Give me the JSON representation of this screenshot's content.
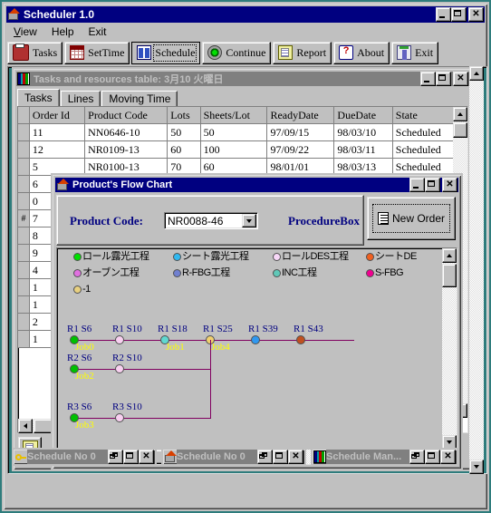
{
  "app": {
    "title": "Scheduler 1.0",
    "icon": "house-icon",
    "menu": [
      "View",
      "Help",
      "Exit"
    ],
    "window_buttons": [
      "minimize",
      "maximize",
      "close"
    ]
  },
  "toolbar": {
    "buttons": [
      {
        "label": "Tasks",
        "icon": "printer-icon",
        "pressed": false
      },
      {
        "label": "SetTime",
        "icon": "calendar-icon",
        "pressed": false
      },
      {
        "label": "Schedule",
        "icon": "schedule-icon",
        "pressed": true
      },
      {
        "label": "Continue",
        "icon": "green-ball-icon",
        "pressed": false
      },
      {
        "label": "Report",
        "icon": "report-icon",
        "pressed": false
      },
      {
        "label": "About",
        "icon": "about-icon",
        "pressed": false
      },
      {
        "label": "Exit",
        "icon": "exit-door-icon",
        "pressed": false
      }
    ]
  },
  "tasks_window": {
    "title": "Tasks and resources table: 3月10  火曜日",
    "icon": "grid-icon",
    "tabs": [
      {
        "label": "Tasks",
        "active": true
      },
      {
        "label": "Lines",
        "active": false
      },
      {
        "label": "Moving Time",
        "active": false
      }
    ],
    "grid": {
      "columns": [
        "",
        "Order Id",
        "Product Code",
        "Lots",
        "Sheets/Lot",
        "ReadyDate",
        "DueDate",
        "State"
      ],
      "rows": [
        [
          "",
          "11",
          "NN0646-10",
          "50",
          "50",
          "97/09/15",
          "98/03/10",
          "Scheduled"
        ],
        [
          "",
          "12",
          "NR0109-13",
          "60",
          "100",
          "97/09/22",
          "98/03/11",
          "Scheduled"
        ],
        [
          "",
          "5",
          "NR0100-13",
          "70",
          "60",
          "98/01/01",
          "98/03/13",
          "Scheduled"
        ],
        [
          "",
          "6",
          "",
          "",
          "",
          "",
          "",
          ""
        ],
        [
          "",
          "0",
          "",
          "",
          "",
          "",
          "",
          ""
        ],
        [
          "#",
          "7",
          "",
          "",
          "",
          "",
          "",
          ""
        ],
        [
          "",
          "8",
          "",
          "",
          "",
          "",
          "",
          ""
        ],
        [
          "",
          "9",
          "",
          "",
          "",
          "",
          "",
          ""
        ],
        [
          "",
          "4",
          "",
          "",
          "",
          "",
          "",
          ""
        ],
        [
          "",
          "1",
          "",
          "",
          "",
          "",
          "",
          ""
        ],
        [
          "",
          "1",
          "",
          "",
          "",
          "",
          "",
          ""
        ],
        [
          "",
          "2",
          "",
          "",
          "",
          "",
          "",
          ""
        ],
        [
          "",
          "1",
          "",
          "",
          "",
          "",
          "",
          ""
        ]
      ]
    },
    "edit_button_icon": "edit-note-icon"
  },
  "flow_window": {
    "title": "Product's Flow Chart",
    "icon": "house-icon",
    "product_code_label": "Product Code:",
    "product_code_value": "NR0088-46",
    "procedure_label": "ProcedureBox",
    "new_order_label": "New Order",
    "new_order_icon": "document-icon",
    "legend": [
      {
        "label": "ロール露光工程",
        "color": "#00e000"
      },
      {
        "label": "シート露光工程",
        "color": "#30b8f0"
      },
      {
        "label": "ロールDES工程",
        "color": "#f8d8f8"
      },
      {
        "label": "シートDE",
        "color": "#f06020"
      },
      {
        "label": "オーブン工程",
        "color": "#e070e0"
      },
      {
        "label": "R-FBG工程",
        "color": "#7080d0"
      },
      {
        "label": "INC工程",
        "color": "#60c8b8"
      },
      {
        "label": "S-FBG",
        "color": "#f00090"
      },
      {
        "label": "-1",
        "color": "#e8d080"
      }
    ],
    "chart": {
      "rows": [
        {
          "job": "Job0",
          "nodes": [
            {
              "label": "R1  S6",
              "color": "#00c000"
            },
            {
              "label": "R1  S10",
              "color": "#f8d0f0"
            },
            {
              "label": "R1  S18",
              "color": "#60d8d0"
            },
            {
              "label": "R1  S25",
              "color": "#f0d070"
            },
            {
              "label": "R1  S39",
              "color": "#3098f0"
            },
            {
              "label": "R1  S43",
              "color": "#c05020"
            }
          ]
        },
        {
          "job": "Job2",
          "nodes": [
            {
              "label": "R2  S6",
              "color": "#00c000"
            },
            {
              "label": "R2  S10",
              "color": "#f8d0f0"
            }
          ]
        },
        {
          "job": "Job3",
          "nodes": [
            {
              "label": "R3  S6",
              "color": "#00c000"
            },
            {
              "label": "R3  S10",
              "color": "#f8d0f0"
            }
          ]
        }
      ],
      "inline_jobs": [
        "Job1",
        "Job4"
      ]
    }
  },
  "minimized_windows": [
    {
      "title": "Schedule No 0",
      "icon": "key-icon"
    },
    {
      "title": "Schedule No 0",
      "icon": "house-icon"
    },
    {
      "title": "Schedule Man...",
      "icon": "grid-icon"
    }
  ]
}
